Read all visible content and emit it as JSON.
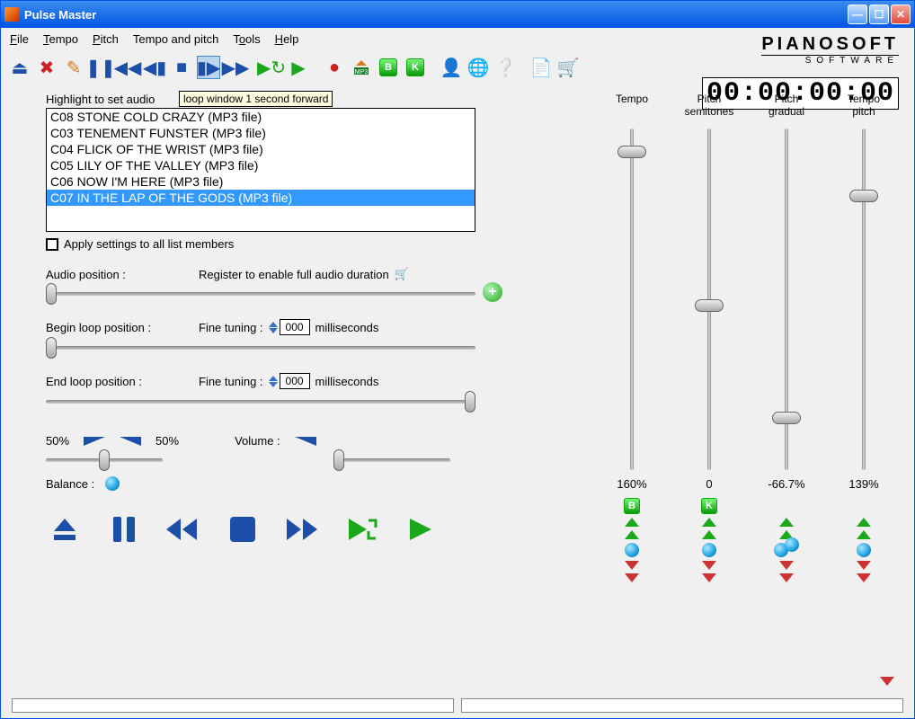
{
  "window": {
    "title": "Pulse Master"
  },
  "menu": {
    "file": "File",
    "tempo": "Tempo",
    "pitch": "Pitch",
    "tempopitch": "Tempo and pitch",
    "tools": "Tools",
    "help": "Help"
  },
  "brand": {
    "main": "PIANOSOFT",
    "sub": "SOFTWARE"
  },
  "timer": "00:00:00:00",
  "tooltip": "loop window 1 second forward",
  "listbox": {
    "label": "Highlight to set audio",
    "items": [
      "C08 STONE COLD CRAZY (MP3 file)",
      "C03 TENEMENT FUNSTER (MP3 file)",
      "C04 FLICK OF THE  WRIST (MP3 file)",
      "C05 LILY OF THE VALLEY (MP3 file)",
      "C06 NOW I'M HERE (MP3 file)",
      "C07 IN THE LAP OF THE GODS (MP3 file)"
    ],
    "selected_index": 5
  },
  "apply_all": {
    "label": "Apply settings to all list members",
    "checked": false
  },
  "audio_position": {
    "label": "Audio position :",
    "note": "Register to enable full audio duration",
    "value_pct": 0
  },
  "begin_loop": {
    "label": "Begin loop position :",
    "fine_label": "Fine tuning :",
    "fine_value": "000",
    "unit": "milliseconds",
    "value_pct": 0
  },
  "end_loop": {
    "label": "End loop position :",
    "fine_label": "Fine tuning :",
    "fine_value": "000",
    "unit": "milliseconds",
    "value_pct": 100
  },
  "balance": {
    "left_label": "50%",
    "right_label": "50%",
    "volume_label": "Volume :",
    "label": "Balance :",
    "value_pct": 50,
    "volume_pct": 0
  },
  "sliders": {
    "tempo": {
      "label": "Tempo",
      "value": "160%",
      "pos_pct": 5
    },
    "pitch_semi": {
      "label": "Pitch semitones",
      "value": "0",
      "pos_pct": 50
    },
    "pitch_grad": {
      "label": "Pitch gradual",
      "value": "-66.7%",
      "pos_pct": 83
    },
    "tempo_pitch": {
      "label": "Tempo pitch",
      "value": "139%",
      "pos_pct": 18
    }
  },
  "col_markers": {
    "b": "B",
    "k": "K"
  }
}
